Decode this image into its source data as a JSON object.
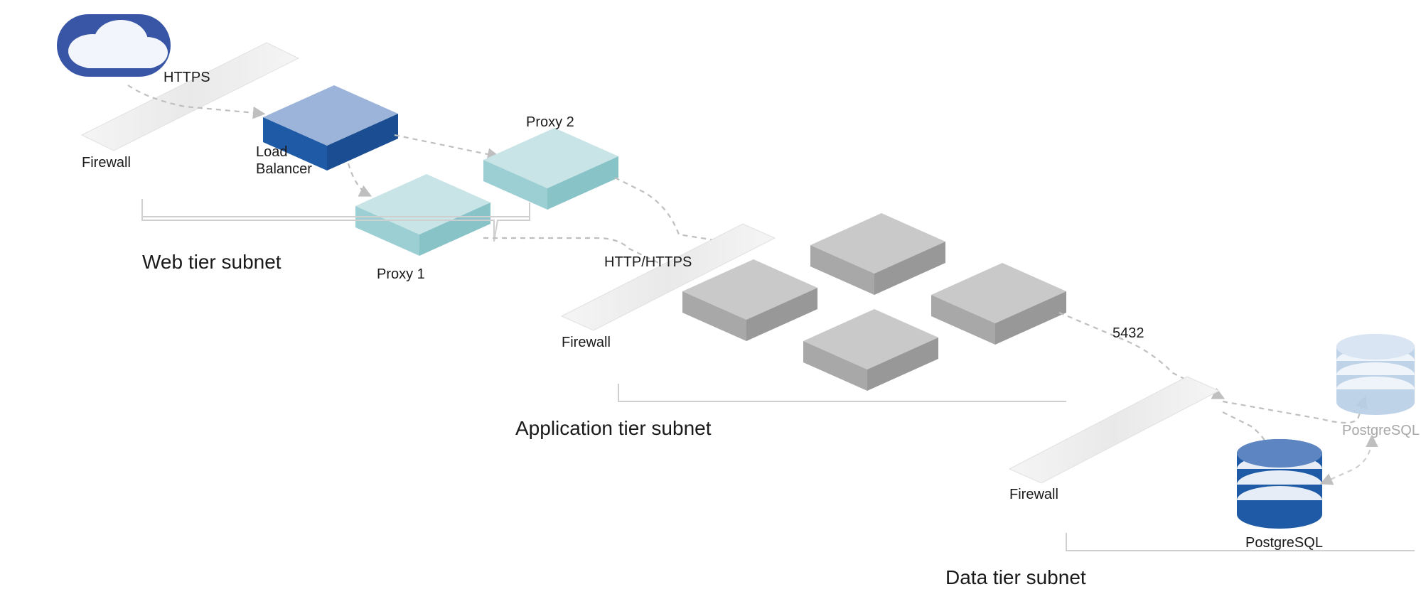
{
  "protocols": {
    "https": "HTTPS",
    "http_https": "HTTP/HTTPS",
    "port": "5432"
  },
  "labels": {
    "cloud": "cloud",
    "firewall1": "Firewall",
    "firewall2": "Firewall",
    "firewall3": "Firewall",
    "load_balancer_l1": "Load",
    "load_balancer_l2": "Balancer",
    "proxy1": "Proxy 1",
    "proxy2": "Proxy 2",
    "postgres1": "PostgreSQL",
    "postgres2": "PostgreSQL"
  },
  "tiers": {
    "web": "Web tier subnet",
    "app": "Application tier subnet",
    "data": "Data tier subnet"
  }
}
